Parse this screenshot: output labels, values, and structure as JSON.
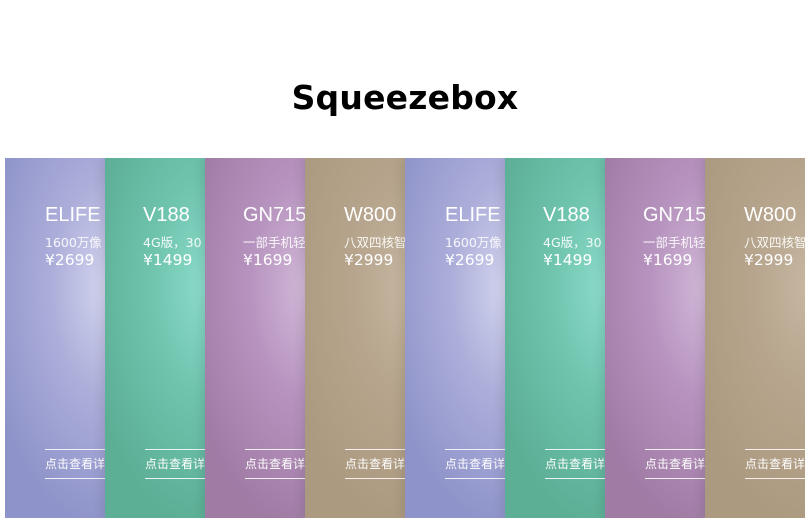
{
  "page": {
    "title": "Squeezebox"
  },
  "panels": [
    {
      "name": "ELIFE E",
      "desc": "1600万像",
      "price": "¥2699",
      "more": "点击查看详"
    },
    {
      "name": "V188",
      "desc": "4G版，30",
      "price": "¥1499",
      "more": "点击查看详"
    },
    {
      "name": "GN715",
      "desc": "一部手机轻",
      "price": "¥1699",
      "more": "点击查看详"
    },
    {
      "name": "W800",
      "desc": "八双四核智",
      "price": "¥2999",
      "more": "点击查看详"
    },
    {
      "name": "ELIFE E",
      "desc": "1600万像",
      "price": "¥2699",
      "more": "点击查看详"
    },
    {
      "name": "V188",
      "desc": "4G版，30",
      "price": "¥1499",
      "more": "点击查看详"
    },
    {
      "name": "GN715",
      "desc": "一部手机轻",
      "price": "¥1699",
      "more": "点击查看详"
    },
    {
      "name": "W800",
      "desc": "八双四核智",
      "price": "¥2999",
      "more": "点击查看详"
    }
  ],
  "colors": {
    "blue": "#8e93c9",
    "teal": "#5cae95",
    "purple": "#a07ca5",
    "tan": "#ab9a80"
  }
}
